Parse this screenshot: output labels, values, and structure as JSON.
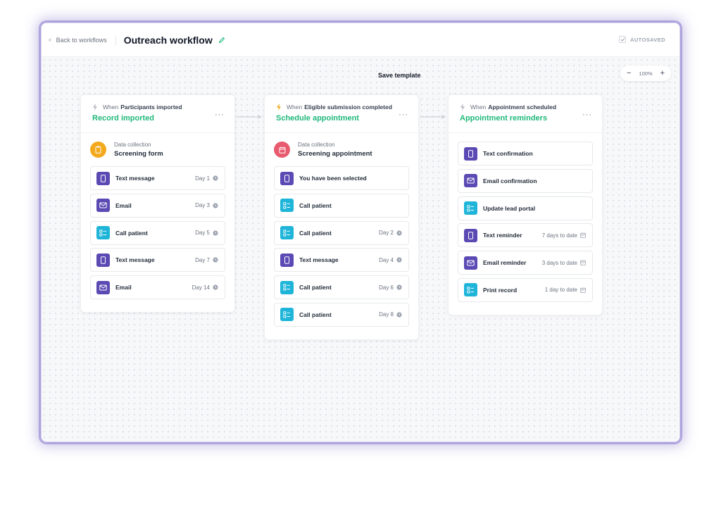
{
  "topbar": {
    "back_label": "Back to workflows",
    "title": "Outreach workflow",
    "autosaved": "AUTOSAVED"
  },
  "canvas": {
    "save_template": "Save template",
    "zoom": {
      "minus": "−",
      "value": "100%",
      "plus": "+"
    }
  },
  "colors": {
    "accent_green": "#1fb87a",
    "purple": "#5b4ab4",
    "teal": "#1fb5d9",
    "orange": "#f2a91d",
    "red": "#e85a6e"
  },
  "cards": [
    {
      "trigger_prefix": "When",
      "trigger": "Participants imported",
      "title": "Record imported",
      "more": "···",
      "collection": {
        "label": "Data collection",
        "name": "Screening form",
        "icon": "clipboard-icon"
      },
      "steps": [
        {
          "label": "Text message",
          "meta": "Day 1",
          "icon": "phone-icon"
        },
        {
          "label": "Email",
          "meta": "Day 3",
          "icon": "mail-icon"
        },
        {
          "label": "Call patient",
          "meta": "Day 5",
          "icon": "checklist-icon"
        },
        {
          "label": "Text message",
          "meta": "Day 7",
          "icon": "phone-icon"
        },
        {
          "label": "Email",
          "meta": "Day 14",
          "icon": "mail-icon"
        }
      ]
    },
    {
      "trigger_prefix": "When",
      "trigger": "Eligible submission completed",
      "title": "Schedule appointment",
      "more": "···",
      "collection": {
        "label": "Data collection",
        "name": "Screening appointment",
        "icon": "calendar-icon"
      },
      "steps": [
        {
          "label": "You have been selected",
          "meta": "",
          "icon": "phone-icon"
        },
        {
          "label": "Call patient",
          "meta": "",
          "icon": "checklist-icon"
        },
        {
          "label": "Call patient",
          "meta": "Day 2",
          "icon": "checklist-icon"
        },
        {
          "label": "Text message",
          "meta": "Day 4",
          "icon": "phone-icon"
        },
        {
          "label": "Call patient",
          "meta": "Day 6",
          "icon": "checklist-icon"
        },
        {
          "label": "Call patient",
          "meta": "Day 8",
          "icon": "checklist-icon"
        }
      ]
    },
    {
      "trigger_prefix": "When",
      "trigger": "Appointment scheduled",
      "title": "Appointment reminders",
      "more": "···",
      "steps": [
        {
          "label": "Text confirmation",
          "meta": "",
          "icon": "phone-icon"
        },
        {
          "label": "Email confirmation",
          "meta": "",
          "icon": "mail-icon"
        },
        {
          "label": "Update lead portal",
          "meta": "",
          "icon": "checklist-icon"
        },
        {
          "label": "Text reminder",
          "meta": "7 days to date",
          "icon": "phone-icon"
        },
        {
          "label": "Email reminder",
          "meta": "3 days to date",
          "icon": "mail-icon"
        },
        {
          "label": "Print record",
          "meta": "1 day to date",
          "icon": "checklist-icon"
        }
      ]
    }
  ]
}
